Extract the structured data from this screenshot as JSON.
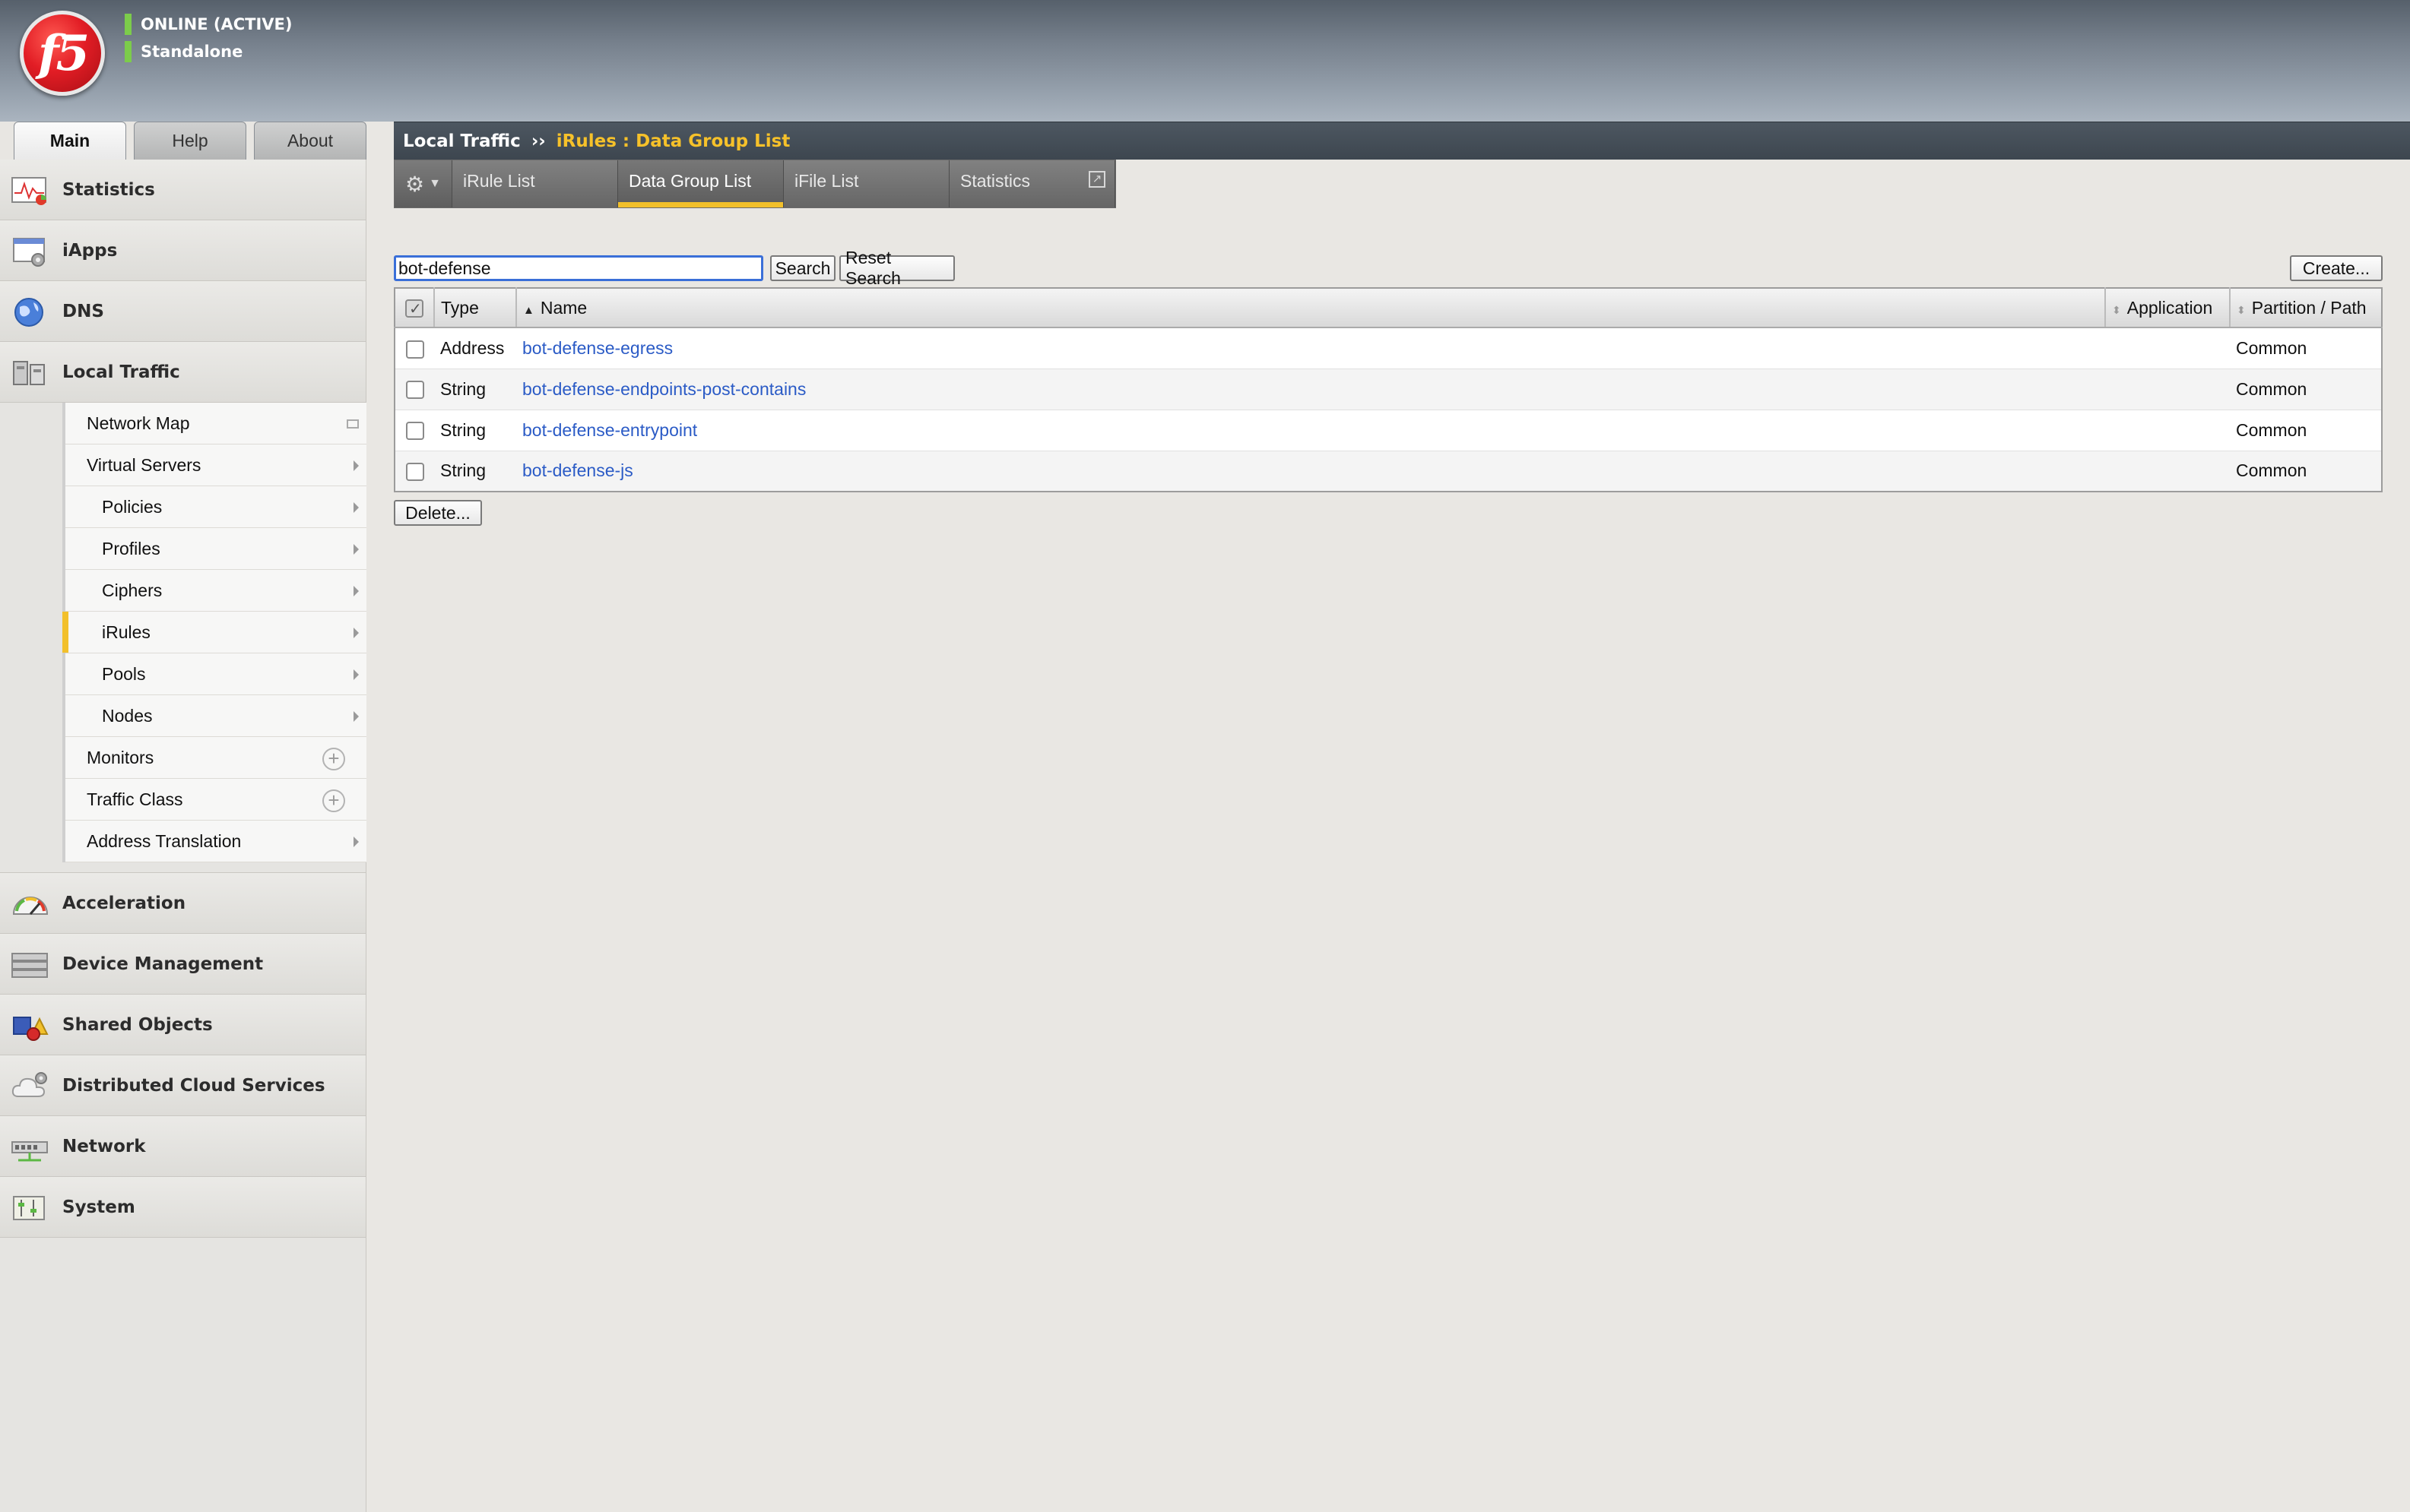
{
  "header": {
    "logo_text": "f5",
    "status_line1": "ONLINE (ACTIVE)",
    "status_line2": "Standalone"
  },
  "nav_tabs": [
    {
      "label": "Main"
    },
    {
      "label": "Help"
    },
    {
      "label": "About"
    }
  ],
  "sidebar": {
    "sections_top": [
      {
        "label": "Statistics",
        "icon": "statistics-icon"
      },
      {
        "label": "iApps",
        "icon": "iapps-icon"
      },
      {
        "label": "DNS",
        "icon": "dns-icon"
      },
      {
        "label": "Local Traffic",
        "icon": "local-traffic-icon"
      }
    ],
    "submenu": [
      {
        "label": "Network Map"
      },
      {
        "label": "Virtual Servers"
      },
      {
        "label": "Policies"
      },
      {
        "label": "Profiles"
      },
      {
        "label": "Ciphers"
      },
      {
        "label": "iRules"
      },
      {
        "label": "Pools"
      },
      {
        "label": "Nodes"
      },
      {
        "label": "Monitors"
      },
      {
        "label": "Traffic Class"
      },
      {
        "label": "Address Translation"
      }
    ],
    "sections_bottom": [
      {
        "label": "Acceleration",
        "icon": "acceleration-icon"
      },
      {
        "label": "Device Management",
        "icon": "device-management-icon"
      },
      {
        "label": "Shared Objects",
        "icon": "shared-objects-icon"
      },
      {
        "label": "Distributed Cloud Services",
        "icon": "cloud-icon"
      },
      {
        "label": "Network",
        "icon": "network-icon"
      },
      {
        "label": "System",
        "icon": "system-icon"
      }
    ]
  },
  "breadcrumb": {
    "root": "Local Traffic",
    "separator": "››",
    "current": "iRules : Data Group List"
  },
  "tabs": [
    {
      "label": "iRule List"
    },
    {
      "label": "Data Group List"
    },
    {
      "label": "iFile List"
    },
    {
      "label": "Statistics"
    }
  ],
  "search": {
    "value": "bot-defense",
    "search_label": "Search",
    "reset_label": "Reset Search",
    "create_label": "Create..."
  },
  "table": {
    "columns": {
      "type": "Type",
      "name": "Name",
      "application": "Application",
      "partition": "Partition / Path"
    },
    "rows": [
      {
        "type": "Address",
        "name": "bot-defense-egress",
        "application": "",
        "partition": "Common"
      },
      {
        "type": "String",
        "name": "bot-defense-endpoints-post-contains",
        "application": "",
        "partition": "Common"
      },
      {
        "type": "String",
        "name": "bot-defense-entrypoint",
        "application": "",
        "partition": "Common"
      },
      {
        "type": "String",
        "name": "bot-defense-js",
        "application": "",
        "partition": "Common"
      }
    ],
    "delete_label": "Delete..."
  },
  "colors": {
    "accent": "#f2c02b",
    "status_green": "#7ccc4b",
    "link": "#2b5bc6",
    "brand_red": "#e21d25"
  }
}
